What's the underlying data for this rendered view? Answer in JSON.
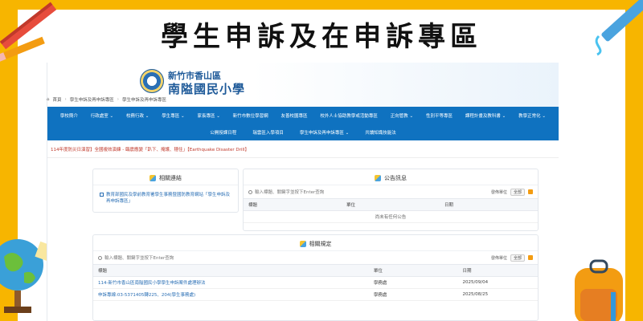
{
  "poster": {
    "title": "學生申訴及在申訴專區"
  },
  "site": {
    "district": "新竹市香山區",
    "name": "南隘國民小學"
  },
  "nav": {
    "row1": [
      "學校簡介",
      "行政處室 ⌄",
      "校務行政 ⌄",
      "學生專區 ⌄",
      "家長專區 ⌄",
      "新竹市數位學習網",
      "友善校園專區",
      "校外人士協助教學或活動專區",
      "正向管教 ⌄",
      "性別平等專區",
      "課程計畫及教科書 ⌄",
      "教學正常化 ⌄"
    ],
    "row2": [
      "公開授課日程",
      "瑞雲區入學項目",
      "學生申訴及再申訴專區 ⌄",
      "共讀知識技能法"
    ]
  },
  "ticker": {
    "text": "114年度防災日演習】全國複效演練 - 臨震應變「趴下、掩護、穩住」【Earthquake Disaster Drill】"
  },
  "breadcrumb": {
    "home": "首頁",
    "level1": "學生申訴及再申訴專區",
    "level2": "學生申訴及再申訴專區"
  },
  "related_links": {
    "title": "相關連結",
    "item": "教育部國民及學前教育署學生事務暨國防教育網站「學生申訴及再申訴專區」"
  },
  "announcements": {
    "title": "公告訊息",
    "search_placeholder": "輸入標題、關鍵字並按下Enter查詢",
    "filter_label": "發佈單位",
    "filter_value": "全部",
    "columns": [
      "標題",
      "單位",
      "日期"
    ],
    "empty_text": "尚未有任何公告"
  },
  "regulations": {
    "title": "相關規定",
    "search_placeholder": "輸入標題、關鍵字並按下Enter查詢",
    "filter_label": "發佈單位",
    "filter_value": "全部",
    "columns": [
      "標題",
      "單位",
      "日期"
    ],
    "rows": [
      {
        "title": "114-新竹市香山區南隘國民小學學生申訴案件處理辦法",
        "unit": "學務處",
        "date": "2025/09/04"
      },
      {
        "title": "申訴專線:03-5371405轉225、204(學生事務處)",
        "unit": "學務處",
        "date": "2025/08/25"
      }
    ]
  },
  "colors": {
    "nav_bg": "#0f72c0",
    "poster_bg": "#f7b500",
    "brand": "#1e5a99"
  }
}
